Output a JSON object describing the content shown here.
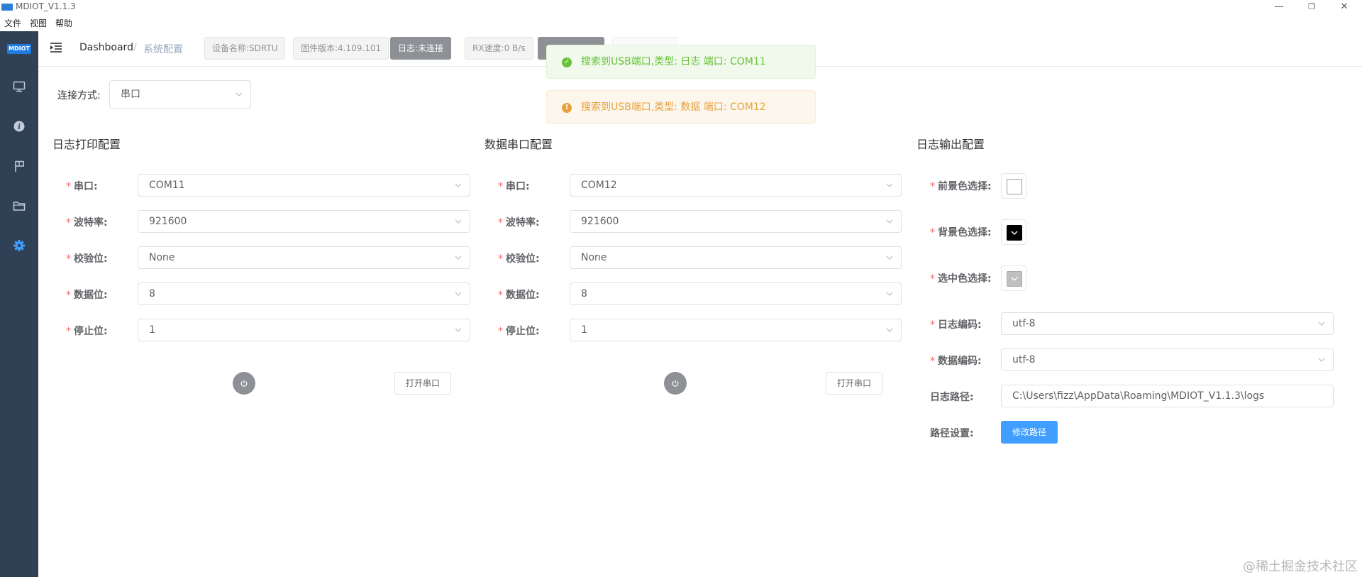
{
  "window": {
    "title": "MDIOT_V1.1.3",
    "controls": [
      "—",
      "❐",
      "✕"
    ]
  },
  "menu": [
    "文件",
    "视图",
    "帮助"
  ],
  "sidebar": {
    "logo": "MDIOT",
    "items": [
      {
        "icon": "monitor-icon"
      },
      {
        "icon": "info-icon"
      },
      {
        "icon": "flag-icon"
      },
      {
        "icon": "folder-icon"
      },
      {
        "icon": "gear-icon",
        "active": true
      }
    ],
    "active_color": "#409eff"
  },
  "breadcrumb": {
    "home": "Dashboard",
    "separator": "/",
    "current": "系统配置"
  },
  "tags": {
    "device": "设备名称:SDRTU",
    "firmware": "固件版本:4.109.101",
    "log_status": "日志:未连接",
    "rx_speed": "RX速度:0 B/s"
  },
  "toasts": {
    "success": {
      "text": "搜索到USB端口,类型: 日志 端口: COM11",
      "icon": "check-circle-icon",
      "color": "#67c23a"
    },
    "warning": {
      "text": "搜索到USB端口,类型: 数据 端口: COM12",
      "icon": "warning-circle-icon",
      "color": "#e6a23c"
    }
  },
  "connection": {
    "label": "连接方式:",
    "value": "串口"
  },
  "log_serial": {
    "title": "日志打印配置",
    "fields": [
      {
        "label": "串口:",
        "value": "COM11"
      },
      {
        "label": "波特率:",
        "value": "921600"
      },
      {
        "label": "校验位:",
        "value": "None"
      },
      {
        "label": "数据位:",
        "value": "8"
      },
      {
        "label": "停止位:",
        "value": "1"
      }
    ],
    "open_button": "打开串口"
  },
  "data_serial": {
    "title": "数据串口配置",
    "fields": [
      {
        "label": "串口:",
        "value": "COM12"
      },
      {
        "label": "波特率:",
        "value": "921600"
      },
      {
        "label": "校验位:",
        "value": "None"
      },
      {
        "label": "数据位:",
        "value": "8"
      },
      {
        "label": "停止位:",
        "value": "1"
      }
    ],
    "open_button": "打开串口"
  },
  "log_output": {
    "title": "日志输出配置",
    "fg_label": "前景色选择:",
    "bg_label": "背景色选择:",
    "sel_label": "选中色选择:",
    "fg_color": "#ffffff",
    "bg_color": "#000000",
    "sel_color": "#c0c0c0",
    "log_encoding_label": "日志编码:",
    "log_encoding": "utf-8",
    "data_encoding_label": "数据编码:",
    "data_encoding": "utf-8",
    "path_label": "日志路径:",
    "path": "C:\\Users\\fizz\\AppData\\Roaming\\MDIOT_V1.1.3\\logs",
    "path_setting_label": "路径设置:",
    "modify_button": "修改路径"
  },
  "watermark": "@稀土掘金技术社区"
}
